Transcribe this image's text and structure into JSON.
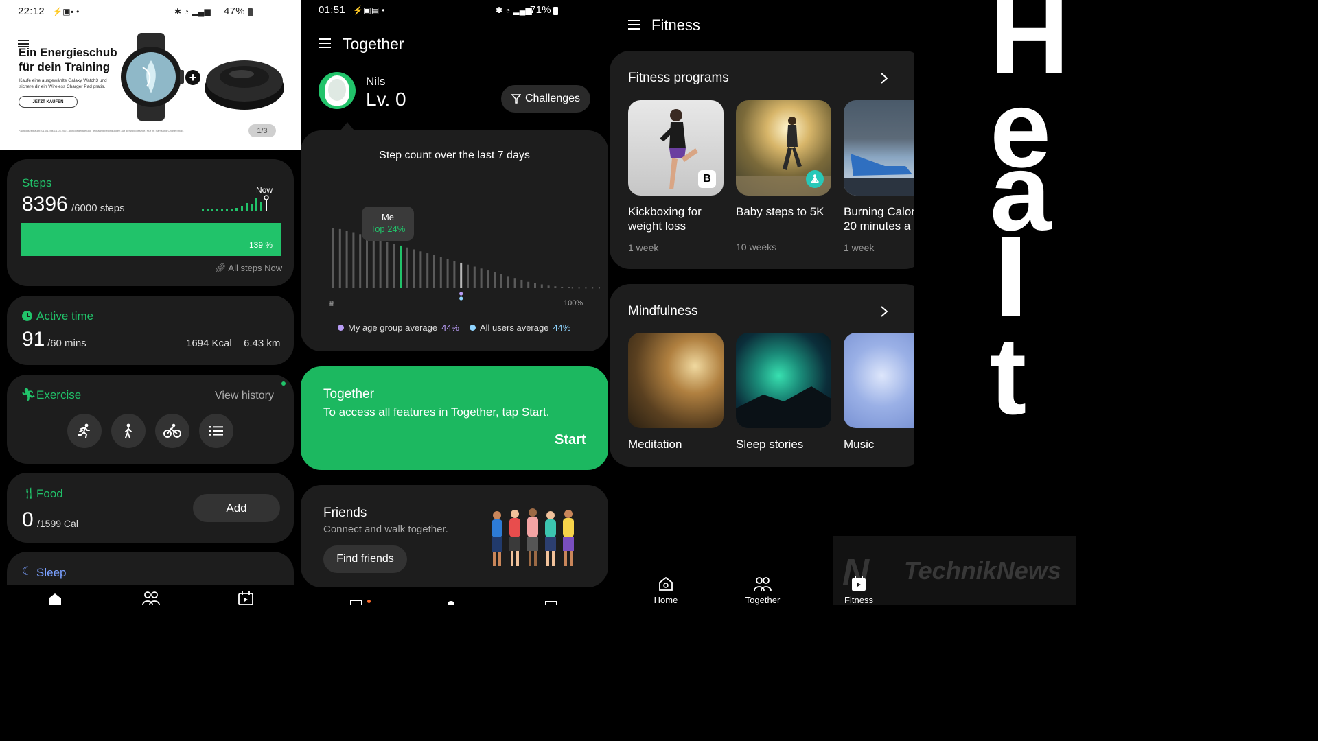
{
  "home": {
    "status": {
      "time": "22:12",
      "battery": "47%"
    },
    "ad": {
      "title1": "Ein Energieschub",
      "title2": "für dein Training",
      "body1": "Kaufe eine ausgewählte Galaxy Watch3 und",
      "body2": "sichere dir ein Wireless Charger Pad gratis.",
      "cta": "JETZT KAUFEN",
      "footnote": "*Aktionszeitraum: 01.04. bis 14.04.2021. Aktionsgeräte und Teilnahmebedingungen auf der Aktionsseite. Nur im Samsung Online Shop.",
      "pager": "1/3"
    },
    "steps": {
      "title": "Steps",
      "value": "8396",
      "goal": "/6000 steps",
      "now": "Now",
      "progress_label": "139 %",
      "progress": 1.0,
      "link": "All steps Now"
    },
    "active": {
      "title": "Active time",
      "value": "91",
      "goal": "/60 mins",
      "kcal": "1694 Kcal",
      "km": "6.43 km"
    },
    "exercise": {
      "title": "Exercise",
      "history": "View history",
      "icons": [
        "running-icon",
        "walking-icon",
        "cycling-icon",
        "list-icon"
      ]
    },
    "food": {
      "title": "Food",
      "value": "0",
      "goal": "/1599 Cal",
      "add": "Add"
    },
    "sleep": {
      "title": "Sleep"
    }
  },
  "together": {
    "status": {
      "time": "01:51",
      "battery": "71%"
    },
    "title": "Together",
    "user": {
      "name": "Nils",
      "level": "Lv. 0"
    },
    "challenges": "Challenges",
    "chart_data": {
      "type": "bar",
      "title": "Step count over the last 7 days",
      "values": [
        95,
        93,
        90,
        88,
        85,
        82,
        79,
        76,
        73,
        70,
        67,
        64,
        61,
        58,
        55,
        52,
        49,
        46,
        43,
        40,
        37,
        34,
        31,
        28,
        25,
        22,
        19,
        16,
        13,
        10,
        8,
        6,
        4,
        3,
        2,
        1
      ],
      "highlight_index": 10,
      "marker_index": 19,
      "me_label": "Me",
      "me_value": "Top 24%",
      "end_label": "100%",
      "legend": [
        {
          "name": "My age group average",
          "value": "44%",
          "color": "#b89cf5"
        },
        {
          "name": "All users average",
          "value": "44%",
          "color": "#8fd4ff"
        }
      ]
    },
    "banner": {
      "title": "Together",
      "body": "To access all features in Together, tap Start.",
      "start": "Start"
    },
    "friends": {
      "title": "Friends",
      "body": "Connect and walk together.",
      "button": "Find friends"
    }
  },
  "fitness": {
    "title": "Fitness",
    "programs": {
      "title": "Fitness programs",
      "items": [
        {
          "line1": "Kickboxing for",
          "line2": "weight loss",
          "duration": "1 week"
        },
        {
          "line1": "Baby steps to 5K",
          "line2": "",
          "duration": "10 weeks"
        },
        {
          "line1": "Burning Calori",
          "line2": "20 minutes a",
          "duration": "1 week"
        }
      ]
    },
    "mindfulness": {
      "title": "Mindfulness",
      "items": [
        {
          "label": "Meditation"
        },
        {
          "label": "Sleep stories"
        },
        {
          "label": "Music"
        }
      ]
    },
    "nav": {
      "home": "Home",
      "together": "Together",
      "fitness": "Fitness"
    }
  },
  "overlay": {
    "letters": [
      "H",
      "e",
      "a",
      "l",
      "t"
    ],
    "watermark": "TechnikNews"
  },
  "colors": {
    "accent": "#21c36a",
    "card": "#1d1d1d",
    "bg": "#000000"
  }
}
